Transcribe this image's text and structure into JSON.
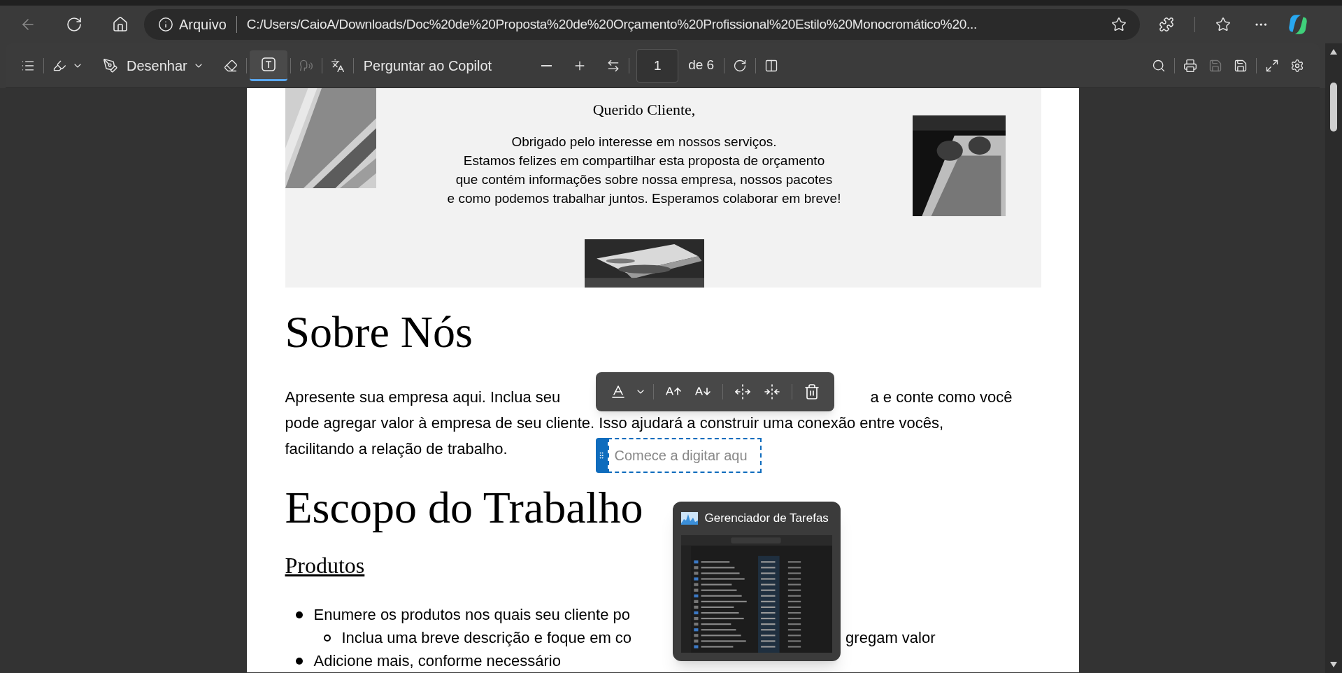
{
  "browser": {
    "address_label": "Arquivo",
    "url": "C:/Users/CaioA/Downloads/Doc%20de%20Proposta%20de%20Orçamento%20Profissional%20Estilo%20Monocromático%20..."
  },
  "pdf_toolbar": {
    "draw_label": "Desenhar",
    "text_tool_selected": true,
    "copilot_label": "Perguntar ao Copilot",
    "page_number": "1",
    "page_total": "de 6"
  },
  "document": {
    "greeting": "Querido Cliente,",
    "intro_lines": [
      "Obrigado pelo interesse em nossos serviços.",
      "Estamos felizes em compartilhar esta proposta de orçamento",
      "que contém informações sobre nossa empresa, nossos pacotes",
      "e como podemos trabalhar juntos. Esperamos colaborar em breve!"
    ],
    "about_heading": "Sobre Nós",
    "about_lines": [
      {
        "parts": [
          "Apresente sua empresa aqui. Inclua seu",
          "a e conte como você"
        ]
      },
      {
        "parts": [
          "pode agregar valor à empresa de seu cliente. Isso ajudará a construir uma conexão entre vocês,"
        ]
      },
      {
        "parts": [
          "facilitando a relação de trabalho."
        ]
      }
    ],
    "scope_heading": "Escopo do Trabalho",
    "products_heading": "Produtos",
    "bullets": [
      {
        "parts": [
          "Enumere os produtos nos quais seu cliente po"
        ],
        "children": [
          {
            "parts": [
              "Inclua uma breve descrição e foque em co",
              "gregam valor"
            ]
          }
        ]
      },
      {
        "parts": [
          "Adicione mais, conforme necessário"
        ]
      }
    ]
  },
  "text_box": {
    "placeholder": "Comece a digitar aqu"
  },
  "task_preview": {
    "title": "Gerenciador de Tarefas",
    "kind": "picture"
  }
}
